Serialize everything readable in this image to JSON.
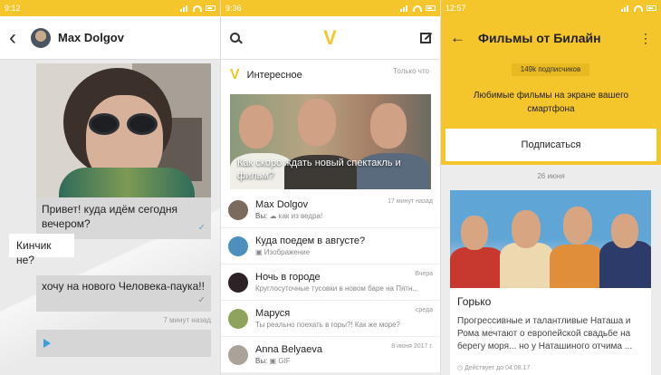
{
  "colors": {
    "accent": "#f4c62c",
    "tick": "#6fa3c6",
    "play": "#3c9fd8"
  },
  "screen1": {
    "status_time": "9:12",
    "back_icon": "chevron-left-icon",
    "contact_name": "Max Dolgov",
    "messages": [
      {
        "text": "Привет! куда идём сегодня вечером?"
      },
      {
        "text": "Кинчик не?"
      },
      {
        "text": "хочу на нового Человека-паука!!"
      }
    ],
    "timestamp": "7 минут назад"
  },
  "screen2": {
    "status_time": "9:36",
    "featured": {
      "title": "Интересное",
      "time": "Только что",
      "caption": "Как скоро ждать новый спектакль и фильм?"
    },
    "items": [
      {
        "name": "Max Dolgov",
        "prefix": "Вы:",
        "sub": "как из ведра!",
        "time": "17 минут назад",
        "avatar": "#7b6b5e"
      },
      {
        "name": "Куда поедем в августе?",
        "prefix": "",
        "sub": "Изображение",
        "time": "",
        "avatar": "#4e8fbf"
      },
      {
        "name": "Ночь в городе",
        "prefix": "",
        "sub": "Круглосуточные тусовки в новом баре на Пятн...",
        "time": "Вчера",
        "avatar": "#2d2226"
      },
      {
        "name": "Маруся",
        "prefix": "",
        "sub": "Ты реально поехать в горы?! Как же море?",
        "time": "среда",
        "avatar": "#8ea45d"
      },
      {
        "name": "Anna Belyaeva",
        "prefix": "Вы:",
        "sub": "GIF",
        "time": "8 июня 2017 г.",
        "avatar": "#a9a39a"
      }
    ]
  },
  "screen3": {
    "status_time": "12:57",
    "title": "Фильмы от Билайн",
    "subscribers": "149k подписчиков",
    "description": "Любимые фильмы на экране вашего смартфона",
    "subscribe_label": "Подписаться",
    "date": "26 июня",
    "card": {
      "title": "Горько",
      "description": "Прогрессивные и талантливые Наташа и Рома мечтают о европейской свадьбе на берегу моря... но у Наташиного отчима ...",
      "footer": "Действует до 04.08.17"
    }
  }
}
